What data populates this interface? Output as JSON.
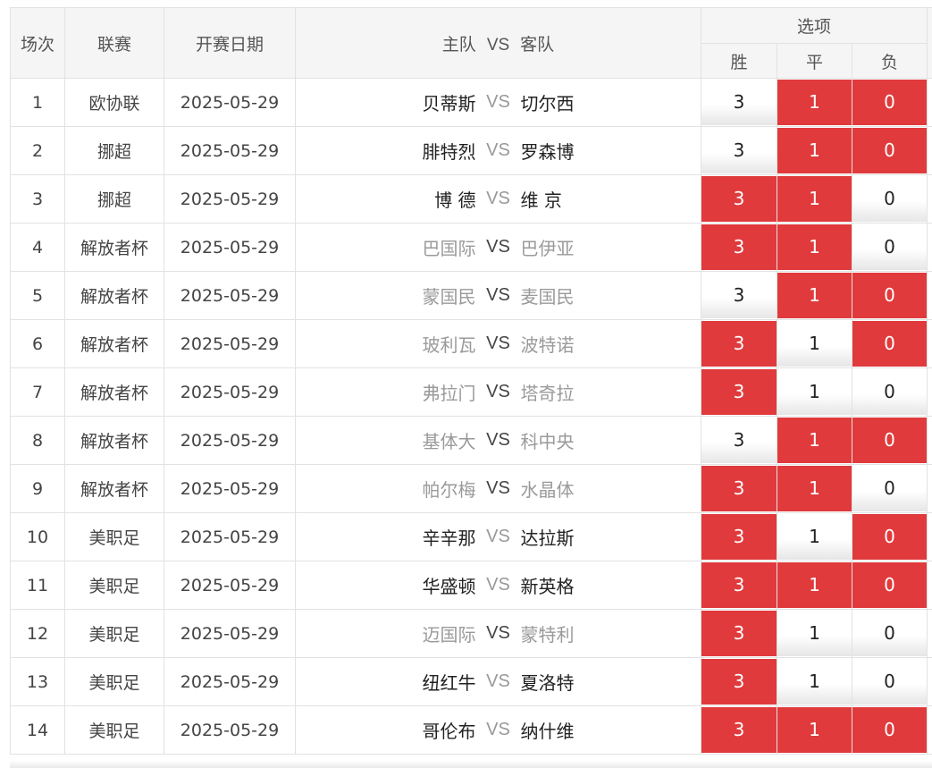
{
  "header": {
    "col_index": "场次",
    "col_league": "联赛",
    "col_date": "开赛日期",
    "col_home": "主队",
    "col_vs": "VS",
    "col_away": "客队",
    "col_options": "选项",
    "opt_win": "胜",
    "opt_draw": "平",
    "opt_lose": "负"
  },
  "colors": {
    "selected": "#e03a3c",
    "header_bg": "#f5f5f5",
    "border": "#e2e2e2"
  },
  "rows": [
    {
      "no": "1",
      "league": "欧协联",
      "date": "2025-05-29",
      "home": "贝蒂斯",
      "vs": "VS",
      "away": "切尔西",
      "dim": false,
      "w": "3",
      "d": "1",
      "l": "0",
      "sel": [
        false,
        true,
        true
      ]
    },
    {
      "no": "2",
      "league": "挪超",
      "date": "2025-05-29",
      "home": "腓特烈",
      "vs": "VS",
      "away": "罗森博",
      "dim": false,
      "w": "3",
      "d": "1",
      "l": "0",
      "sel": [
        false,
        true,
        true
      ]
    },
    {
      "no": "3",
      "league": "挪超",
      "date": "2025-05-29",
      "home": "博 德",
      "vs": "VS",
      "away": "维 京",
      "dim": false,
      "w": "3",
      "d": "1",
      "l": "0",
      "sel": [
        true,
        true,
        false
      ]
    },
    {
      "no": "4",
      "league": "解放者杯",
      "date": "2025-05-29",
      "home": "巴国际",
      "vs": "VS",
      "away": "巴伊亚",
      "dim": true,
      "w": "3",
      "d": "1",
      "l": "0",
      "sel": [
        true,
        true,
        false
      ]
    },
    {
      "no": "5",
      "league": "解放者杯",
      "date": "2025-05-29",
      "home": "蒙国民",
      "vs": "VS",
      "away": "麦国民",
      "dim": true,
      "w": "3",
      "d": "1",
      "l": "0",
      "sel": [
        false,
        true,
        true
      ]
    },
    {
      "no": "6",
      "league": "解放者杯",
      "date": "2025-05-29",
      "home": "玻利瓦",
      "vs": "VS",
      "away": "波特诺",
      "dim": true,
      "w": "3",
      "d": "1",
      "l": "0",
      "sel": [
        true,
        false,
        true
      ]
    },
    {
      "no": "7",
      "league": "解放者杯",
      "date": "2025-05-29",
      "home": "弗拉门",
      "vs": "VS",
      "away": "塔奇拉",
      "dim": true,
      "w": "3",
      "d": "1",
      "l": "0",
      "sel": [
        true,
        false,
        false
      ]
    },
    {
      "no": "8",
      "league": "解放者杯",
      "date": "2025-05-29",
      "home": "基体大",
      "vs": "VS",
      "away": "科中央",
      "dim": true,
      "w": "3",
      "d": "1",
      "l": "0",
      "sel": [
        false,
        true,
        true
      ]
    },
    {
      "no": "9",
      "league": "解放者杯",
      "date": "2025-05-29",
      "home": "帕尔梅",
      "vs": "VS",
      "away": "水晶体",
      "dim": true,
      "w": "3",
      "d": "1",
      "l": "0",
      "sel": [
        true,
        true,
        false
      ]
    },
    {
      "no": "10",
      "league": "美职足",
      "date": "2025-05-29",
      "home": "辛辛那",
      "vs": "VS",
      "away": "达拉斯",
      "dim": false,
      "w": "3",
      "d": "1",
      "l": "0",
      "sel": [
        true,
        false,
        true
      ]
    },
    {
      "no": "11",
      "league": "美职足",
      "date": "2025-05-29",
      "home": "华盛顿",
      "vs": "VS",
      "away": "新英格",
      "dim": false,
      "w": "3",
      "d": "1",
      "l": "0",
      "sel": [
        true,
        true,
        true
      ]
    },
    {
      "no": "12",
      "league": "美职足",
      "date": "2025-05-29",
      "home": "迈国际",
      "vs": "VS",
      "away": "蒙特利",
      "dim": true,
      "w": "3",
      "d": "1",
      "l": "0",
      "sel": [
        true,
        false,
        false
      ]
    },
    {
      "no": "13",
      "league": "美职足",
      "date": "2025-05-29",
      "home": "纽红牛",
      "vs": "VS",
      "away": "夏洛特",
      "dim": false,
      "w": "3",
      "d": "1",
      "l": "0",
      "sel": [
        true,
        false,
        false
      ]
    },
    {
      "no": "14",
      "league": "美职足",
      "date": "2025-05-29",
      "home": "哥伦布",
      "vs": "VS",
      "away": "纳什维",
      "dim": false,
      "w": "3",
      "d": "1",
      "l": "0",
      "sel": [
        true,
        true,
        true
      ]
    }
  ]
}
